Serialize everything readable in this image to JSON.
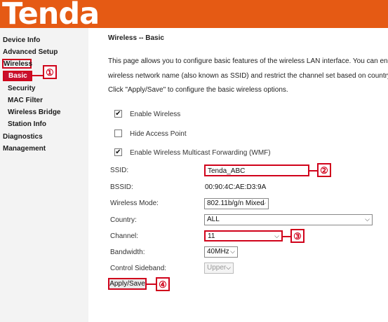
{
  "header": {
    "logo_text": "Tenda",
    "brand_color": "#e55a14"
  },
  "sidebar": {
    "items": [
      {
        "label": "Device Info"
      },
      {
        "label": "Advanced Setup"
      },
      {
        "label": "Wireless"
      },
      {
        "label": "Basic"
      },
      {
        "label": "Security"
      },
      {
        "label": "MAC Filter"
      },
      {
        "label": "Wireless Bridge"
      },
      {
        "label": "Station Info"
      },
      {
        "label": "Diagnostics"
      },
      {
        "label": "Management"
      }
    ]
  },
  "callouts": [
    "①",
    "②",
    "③",
    "④"
  ],
  "main": {
    "title": "Wireless -- Basic",
    "description": [
      "This page allows you to configure basic features of the wireless LAN interface. You can enable or",
      "wireless network name (also known as SSID) and restrict the channel set based on country requi",
      "Click \"Apply/Save\" to configure the basic wireless options."
    ],
    "checkboxes": [
      {
        "label": "Enable Wireless",
        "checked": true
      },
      {
        "label": "Hide Access Point",
        "checked": false
      },
      {
        "label": "Enable Wireless Multicast Forwarding (WMF)",
        "checked": true
      }
    ],
    "fields": {
      "ssid": {
        "label": "SSID:",
        "value": "Tenda_ABC"
      },
      "bssid": {
        "label": "BSSID:",
        "value": "00:90:4C:AE:D3:9A"
      },
      "mode": {
        "label": "Wireless Mode:",
        "value": "802.11b/g/n Mixed"
      },
      "country": {
        "label": "Country:",
        "value": "ALL"
      },
      "channel": {
        "label": "Channel:",
        "value": "11"
      },
      "bandwidth": {
        "label": "Bandwidth:",
        "value": "40MHz"
      },
      "sideband": {
        "label": "Control Sideband:",
        "value": "Upper"
      }
    },
    "apply_label": "Apply/Save"
  },
  "colors": {
    "highlight": "#d0021b"
  },
  "icons": {
    "checkbox_checked": "checkmark-icon",
    "select_arrow": "chevron-down-icon"
  }
}
